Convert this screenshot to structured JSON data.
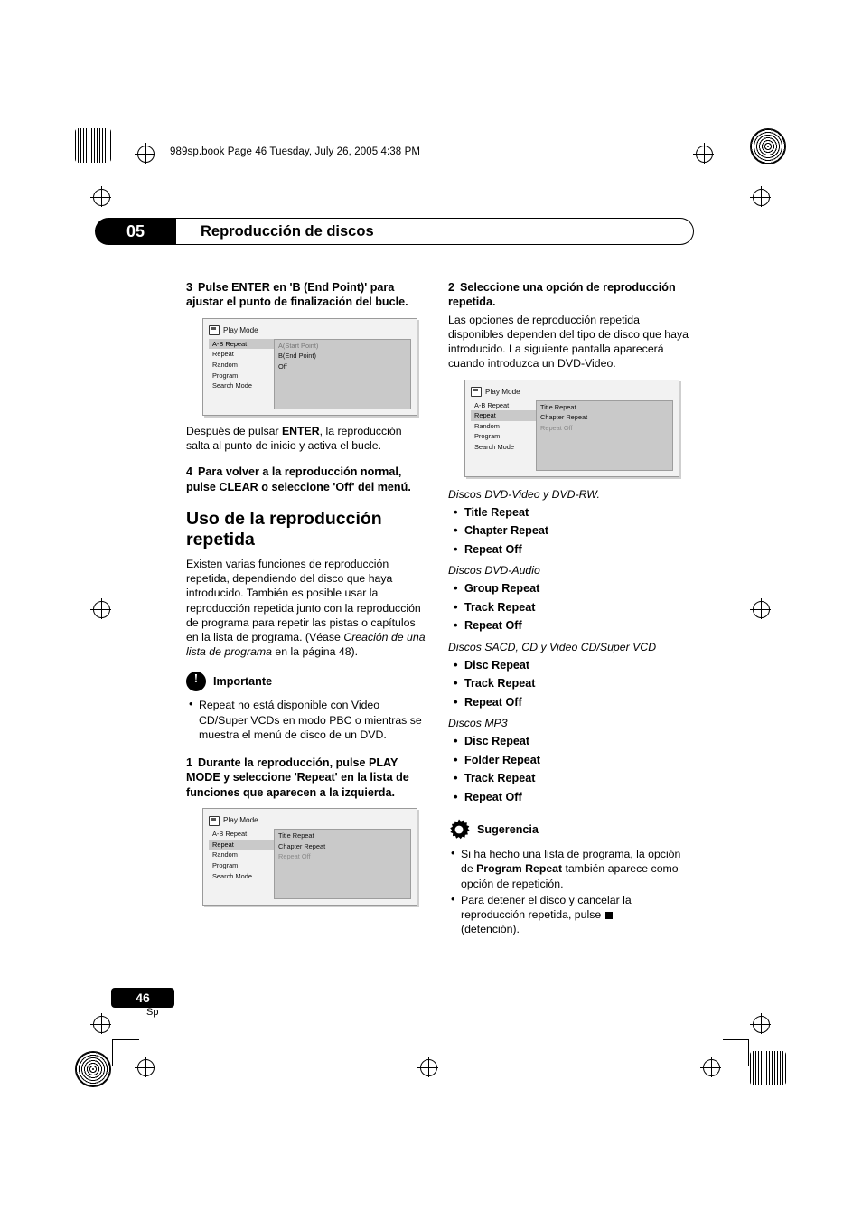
{
  "page": {
    "filestamp": "989sp.book  Page 46  Tuesday, July 26, 2005  4:38 PM",
    "chapter_number": "05",
    "chapter_title": "Reproducción de discos",
    "page_number": "46",
    "page_language_code": "Sp"
  },
  "left_column": {
    "step3": {
      "num": "3",
      "text": "Pulse ENTER en 'B (End Point)' para ajustar el punto de finalización del bucle."
    },
    "osd1": {
      "title": "Play Mode",
      "menu": [
        "A-B Repeat",
        "Repeat",
        "Random",
        "Program",
        "Search Mode"
      ],
      "selected_menu": "A-B Repeat",
      "options": [
        "A(Start Point)",
        "B(End Point)",
        "Off"
      ],
      "highlighted_option": "A(Start Point)"
    },
    "after_osd1": {
      "pre": "Después de pulsar ",
      "bold": "ENTER",
      "post": ", la reproducción salta al punto de inicio y activa el bucle."
    },
    "step4": {
      "num": "4",
      "text": "Para volver a la reproducción normal, pulse CLEAR o seleccione 'Off' del menú."
    },
    "section_title": "Uso de la reproducción repetida",
    "section_body_1": "Existen varias funciones de reproducción repetida, dependiendo del disco que haya introducido. También es posible usar la reproducción repetida junto con la reproducción de programa para repetir las pistas o capítulos en la lista de programa. (Véase ",
    "section_body_italic": "Creación de una lista de programa",
    "section_body_2": " en la página 48).",
    "important": {
      "label": "Importante",
      "bullets": [
        "Repeat no está disponible con Video CD/Super VCDs en modo PBC o mientras se muestra el menú de disco de un DVD."
      ]
    },
    "step1": {
      "num": "1",
      "text": "Durante la reproducción, pulse PLAY MODE y seleccione 'Repeat' en la lista de funciones que aparecen a la izquierda."
    },
    "osd2": {
      "title": "Play Mode",
      "menu": [
        "A-B Repeat",
        "Repeat",
        "Random",
        "Program",
        "Search Mode"
      ],
      "selected_menu": "Repeat",
      "options": [
        "Title Repeat",
        "Chapter Repeat",
        "Repeat Off"
      ],
      "dim_option": "Repeat Off"
    }
  },
  "right_column": {
    "step2": {
      "num": "2",
      "text": "Seleccione una opción de reproducción repetida."
    },
    "step2_body": "Las opciones de reproducción repetida disponibles dependen del tipo de disco que haya introducido. La siguiente pantalla aparecerá cuando introduzca un DVD-Video.",
    "osd3": {
      "title": "Play Mode",
      "menu": [
        "A-B Repeat",
        "Repeat",
        "Random",
        "Program",
        "Search Mode"
      ],
      "selected_menu": "Repeat",
      "options": [
        "Title Repeat",
        "Chapter Repeat",
        "Repeat Off"
      ],
      "dim_option": "Repeat Off"
    },
    "groups": [
      {
        "label": "Discos DVD-Video y DVD-RW.",
        "items": [
          "Title Repeat",
          "Chapter Repeat",
          "Repeat Off"
        ]
      },
      {
        "label": "Discos DVD-Audio",
        "items": [
          "Group Repeat",
          "Track Repeat",
          "Repeat Off"
        ]
      },
      {
        "label": "Discos SACD, CD y Video CD/Super VCD",
        "items": [
          "Disc Repeat",
          "Track Repeat",
          "Repeat Off"
        ]
      },
      {
        "label": "Discos MP3",
        "items": [
          "Disc Repeat",
          "Folder Repeat",
          "Track Repeat",
          "Repeat Off"
        ]
      }
    ],
    "tip": {
      "label": "Sugerencia",
      "bullet1_pre": "Si ha hecho una lista de programa, la opción de ",
      "bullet1_bold": "Program Repeat",
      "bullet1_post": " también aparece como opción de repetición.",
      "bullet2_pre": "Para detener el disco y cancelar la reproducción repetida, pulse ",
      "bullet2_post": "(detención)."
    }
  }
}
